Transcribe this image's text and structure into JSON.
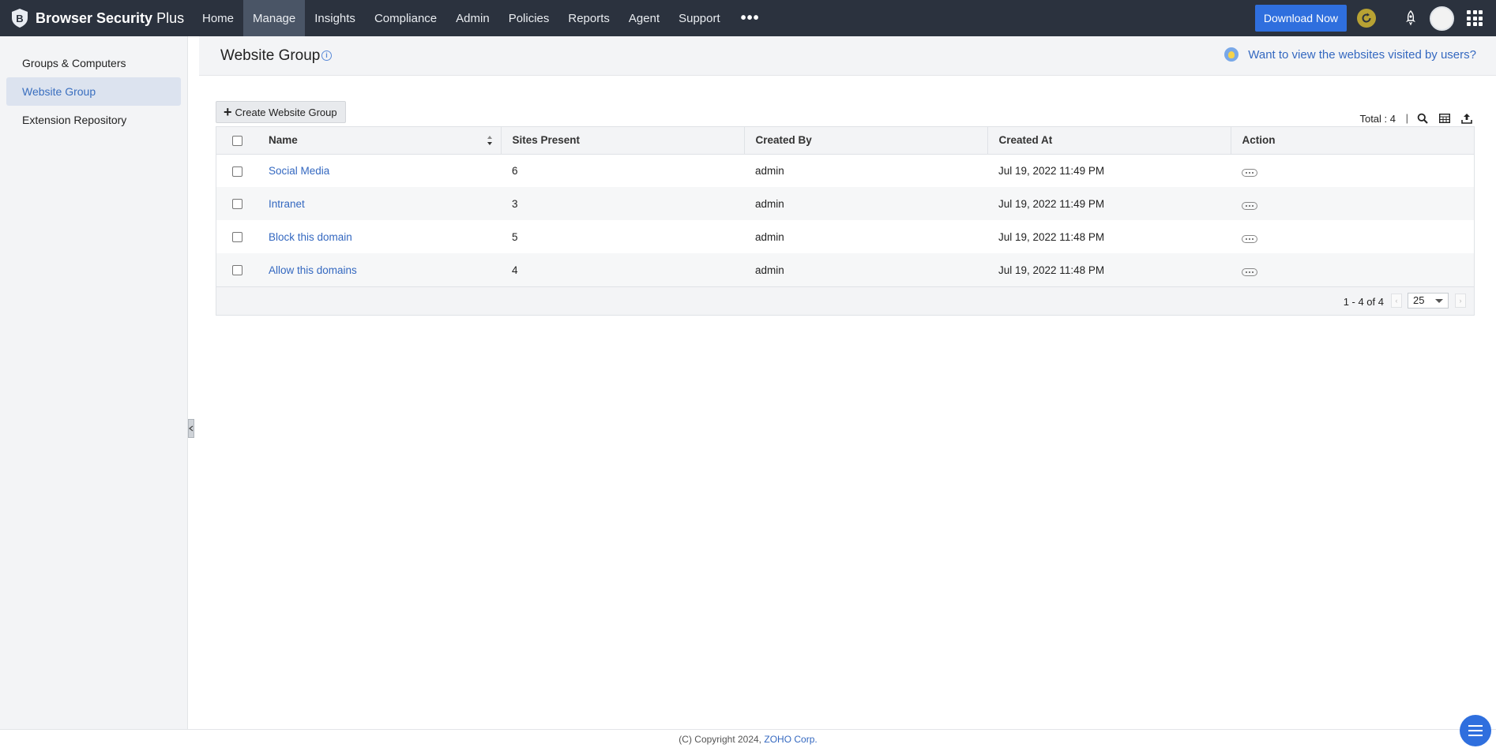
{
  "app": {
    "brand_bold": "Browser Security",
    "brand_light": "Plus"
  },
  "nav": {
    "items": [
      {
        "label": "Home"
      },
      {
        "label": "Manage",
        "active": true
      },
      {
        "label": "Insights"
      },
      {
        "label": "Compliance"
      },
      {
        "label": "Admin"
      },
      {
        "label": "Policies"
      },
      {
        "label": "Reports"
      },
      {
        "label": "Agent"
      },
      {
        "label": "Support"
      }
    ],
    "more_label": "•••",
    "download_label": "Download Now"
  },
  "sidebar": {
    "items": [
      {
        "label": "Groups & Computers"
      },
      {
        "label": "Website Group",
        "active": true
      },
      {
        "label": "Extension Repository"
      }
    ]
  },
  "header": {
    "title": "Website Group",
    "info_glyph": "i",
    "link_text": "Want to view the websites visited by users?"
  },
  "toolbar": {
    "create_label": "Create Website Group",
    "total_text": "Total : 4",
    "separator": "|"
  },
  "table": {
    "columns": [
      "Name",
      "Sites Present",
      "Created By",
      "Created At",
      "Action"
    ],
    "rows": [
      {
        "name": "Social Media",
        "sites": "6",
        "created_by": "admin",
        "created_at": "Jul 19, 2022 11:49 PM"
      },
      {
        "name": "Intranet",
        "sites": "3",
        "created_by": "admin",
        "created_at": "Jul 19, 2022 11:49 PM"
      },
      {
        "name": "Block this domain",
        "sites": "5",
        "created_by": "admin",
        "created_at": "Jul 19, 2022 11:48 PM"
      },
      {
        "name": "Allow this domains",
        "sites": "4",
        "created_by": "admin",
        "created_at": "Jul 19, 2022 11:48 PM"
      }
    ],
    "footer": {
      "range_text": "1 - 4 of 4",
      "page_size": "25",
      "prev_glyph": "‹",
      "next_glyph": "›"
    }
  },
  "footer": {
    "copyright": "(C) Copyright 2024,",
    "company": "ZOHO Corp."
  },
  "colors": {
    "topbar": "#2b323e",
    "accent": "#2f6fde",
    "link": "#3468c0"
  },
  "icons": {
    "logo": "shield-b-icon",
    "refresh": "refresh-icon",
    "rocket": "rocket-icon",
    "apps": "grid-apps-icon",
    "search": "search-icon",
    "columns": "table-columns-icon",
    "export": "export-icon",
    "action": "more-options-icon",
    "chat": "menu-icon"
  }
}
